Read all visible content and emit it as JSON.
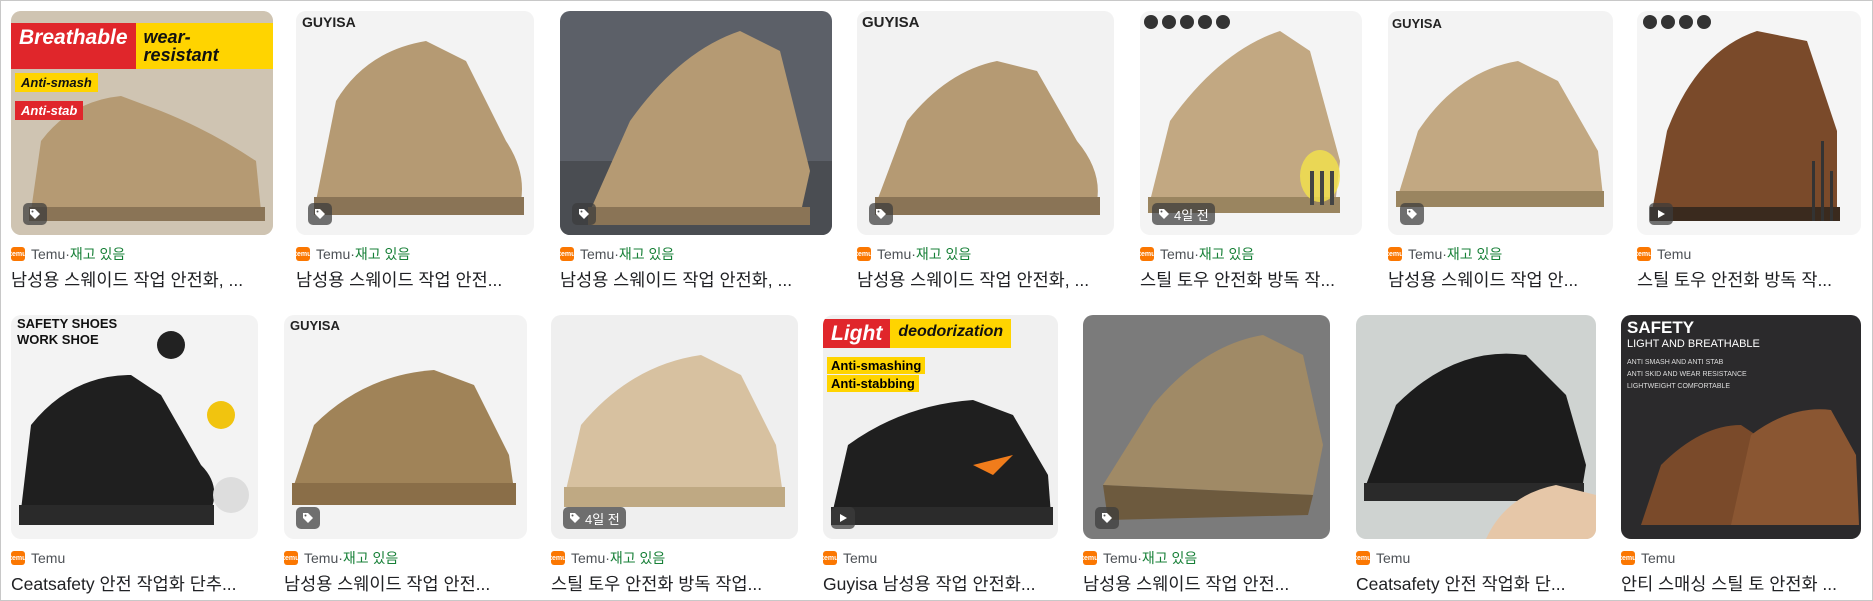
{
  "results": [
    {
      "source": "Temu",
      "stock": "재고 있음",
      "title": "남성용 스웨이드 작업 안전화, ...",
      "badge_text": "",
      "badge_icon": "tag-icon",
      "overlay": {
        "red": "Breathable",
        "yellow": "wear-resistant",
        "sub1": "Anti-smash",
        "sub2": "Anti-stab"
      }
    },
    {
      "source": "Temu",
      "stock": "재고 있음",
      "title": "남성용 스웨이드 작업 안전...",
      "badge_text": "",
      "badge_icon": "tag-icon",
      "brand": "GUYISA"
    },
    {
      "source": "Temu",
      "stock": "재고 있음",
      "title": "남성용 스웨이드 작업 안전화, ...",
      "badge_text": "",
      "badge_icon": "tag-icon"
    },
    {
      "source": "Temu",
      "stock": "재고 있음",
      "title": "남성용 스웨이드 작업 안전화, ...",
      "badge_text": "",
      "badge_icon": "tag-icon",
      "brand": "GUYISA"
    },
    {
      "source": "Temu",
      "stock": "재고 있음",
      "title": "스틸 토우 안전화 방독 작...",
      "badge_text": "4일 전",
      "badge_icon": "tag-icon"
    },
    {
      "source": "Temu",
      "stock": "재고 있음",
      "title": "남성용 스웨이드 작업 안...",
      "badge_text": "",
      "badge_icon": "tag-icon",
      "brand": "GUYISA"
    },
    {
      "source": "Temu",
      "stock": "",
      "title": "스틸 토우 안전화 방독 작...",
      "badge_text": "",
      "badge_icon": "play-icon"
    },
    {
      "source": "Temu",
      "stock": "",
      "title": "Ceatsafety 안전 작업화 단추...",
      "badge_text": "",
      "badge_icon": "",
      "overlay": {
        "line1": "SAFETY SHOES",
        "line2": "WORK  SHOE"
      }
    },
    {
      "source": "Temu",
      "stock": "재고 있음",
      "title": "남성용 스웨이드 작업 안전...",
      "badge_text": "",
      "badge_icon": "tag-icon",
      "brand": "GUYISA"
    },
    {
      "source": "Temu",
      "stock": "재고 있음",
      "title": "스틸 토우 안전화 방독 작업...",
      "badge_text": "4일 전",
      "badge_icon": "tag-icon"
    },
    {
      "source": "Temu",
      "stock": "",
      "title": "Guyisa 남성용 작업 안전화...",
      "badge_text": "",
      "badge_icon": "play-icon",
      "overlay": {
        "red": "Light",
        "yellow": "deodorization",
        "sub1": "Anti-smashing",
        "sub2": "Anti-stabbing"
      }
    },
    {
      "source": "Temu",
      "stock": "재고 있음",
      "title": "남성용 스웨이드 작업 안전...",
      "badge_text": "",
      "badge_icon": "tag-icon"
    },
    {
      "source": "Temu",
      "stock": "",
      "title": "Ceatsafety 안전 작업화 단...",
      "badge_text": "",
      "badge_icon": ""
    },
    {
      "source": "Temu",
      "stock": "",
      "title": "안티 스매싱 스틸 토 안전화 ...",
      "badge_text": "",
      "badge_icon": "",
      "overlay": {
        "line1": "SAFETY",
        "line2": "LIGHT AND BREATHABLE",
        "line3": "ANTI SMASH AND ANTI STAB",
        "line4": "ANTI SKID AND WEAR RESISTANCE",
        "line5": "LIGHTWEIGHT COMFORTABLE"
      }
    }
  ],
  "separator": " · ",
  "colors": {
    "temu": "#fb7701",
    "stock": "#188038",
    "suede": "#b59a73",
    "black": "#1f1f1f",
    "leather": "#7a4a2a"
  }
}
